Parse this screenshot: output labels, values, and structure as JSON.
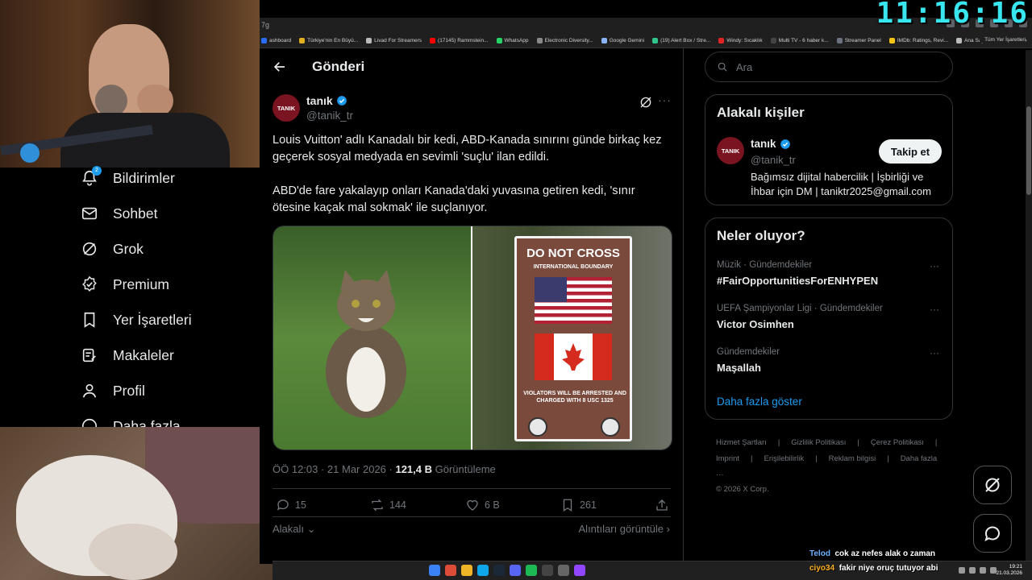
{
  "clock": "11:16:16",
  "browser": {
    "url_fragment": "7g",
    "bookmarks": [
      {
        "label": "ashboard",
        "color": "#2a6df4"
      },
      {
        "label": "Türkiye'nin En Büyü...",
        "color": "#e0b020"
      },
      {
        "label": "Livad For Streamers",
        "color": "#bbbbbb"
      },
      {
        "label": "(17145) Rammstein...",
        "color": "#ff0000"
      },
      {
        "label": "WhatsApp",
        "color": "#25d366"
      },
      {
        "label": "Electronic Diversity...",
        "color": "#888888"
      },
      {
        "label": "Google Gemini",
        "color": "#8ab4f8"
      },
      {
        "label": "(19) Alert Box / Stre...",
        "color": "#31c48d"
      },
      {
        "label": "Windy: Sıcaklık",
        "color": "#e02424"
      },
      {
        "label": "Multi TV - 6 haber k...",
        "color": "#444444"
      },
      {
        "label": "Streamer Panel",
        "color": "#6b7280"
      },
      {
        "label": "IMDb: Ratings, Revi...",
        "color": "#f5c518"
      },
      {
        "label": "Ana Sayfa • HBO Max",
        "color": "#bbbbbb"
      }
    ],
    "bookmarks_more": "»",
    "all_bookmarks": "Tüm Yer İşaretleri"
  },
  "nav": {
    "notifications": "Bildirimler",
    "notifications_badge": "2",
    "messages": "Sohbet",
    "grok": "Grok",
    "premium": "Premium",
    "bookmarks": "Yer İşaretleri",
    "articles": "Makaleler",
    "profile": "Profil",
    "more": "Daha fazla"
  },
  "post": {
    "header_title": "Gönderi",
    "author_name": "tanık",
    "author_handle": "@tanik_tr",
    "avatar_text": "TANIK",
    "text_p1": "Louis Vuitton' adlı Kanadalı bir kedi, ABD-Kanada sınırını günde birkaç kez geçerek sosyal medyada en sevimli 'suçlu' ilan edildi.",
    "text_p2": "ABD'de fare yakalayıp onları Kanada'daki yuvasına getiren kedi, 'sınır ötesine kaçak mal sokmak' ile suçlanıyor.",
    "sign_title": "DO NOT CROSS",
    "sign_sub": "INTERNATIONAL BOUNDARY",
    "sign_warning": "VIOLATORS WILL BE ARRESTED AND CHARGED WITH 8 USC 1325",
    "time": "ÖÖ 12:03 · 21 Mar 2026 · ",
    "views_count": "121,4 B",
    "views_label": " Görüntüleme",
    "replies": "15",
    "reposts": "144",
    "likes": "6 B",
    "bookmarks": "261",
    "relevance": "Alakalı",
    "quotes": "Alıntıları görüntüle"
  },
  "sidebar": {
    "search_placeholder": "Ara",
    "related_title": "Alakalı kişiler",
    "related_name": "tanık",
    "related_handle": "@tanik_tr",
    "related_avatar": "TANIK",
    "follow_label": "Takip et",
    "related_bio": "Bağımsız dijital habercilik | İşbirliği ve İhbar için DM | taniktr2025@gmail.com",
    "trends_title": "Neler oluyor?",
    "trends": [
      {
        "category": "Müzik · Gündemdekiler",
        "name": "#FairOpportunitiesForENHYPEN"
      },
      {
        "category": "UEFA Şampiyonlar Ligi · Gündemdekiler",
        "name": "Victor Osimhen"
      },
      {
        "category": "Gündemdekiler",
        "name": "Maşallah"
      }
    ],
    "show_more": "Daha fazla göster",
    "footer": {
      "terms": "Hizmet Şartları",
      "privacy": "Gizlilik Politikası",
      "cookies": "Çerez Politikası",
      "imprint": "Imprint",
      "accessibility": "Erişilebilirlik",
      "ads": "Reklam bilgisi",
      "more": "Daha fazla ···",
      "copyright": "© 2026 X Corp."
    }
  },
  "chat": [
    {
      "user": "Telod",
      "message": "cok az nefes alak o zaman"
    },
    {
      "user": "ciyo34",
      "message": "fakir niye oruç tutuyor abi"
    }
  ],
  "taskbar": {
    "time": "19:21",
    "date": "21.03.2026"
  },
  "colors": {
    "accent": "#1d9bf0",
    "clock": "#39e6f0",
    "avatar": "#7a1420"
  }
}
